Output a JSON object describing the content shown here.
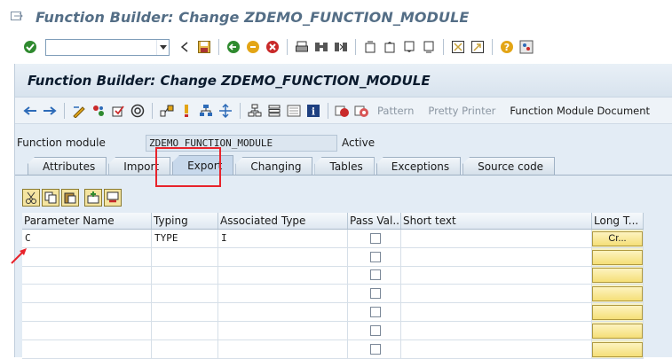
{
  "window": {
    "title": "Function Builder: Change ZDEMO_FUNCTION_MODULE"
  },
  "app": {
    "title": "Function Builder: Change ZDEMO_FUNCTION_MODULE"
  },
  "app_toolbar": {
    "pattern_label": "Pattern",
    "pretty_printer_label": "Pretty Printer",
    "fm_doc_label": "Function Module Document"
  },
  "function_module": {
    "label": "Function module",
    "value": "ZDEMO_FUNCTION_MODULE",
    "status": "Active"
  },
  "tabs": [
    {
      "label": "Attributes"
    },
    {
      "label": "Import"
    },
    {
      "label": "Export"
    },
    {
      "label": "Changing"
    },
    {
      "label": "Tables"
    },
    {
      "label": "Exceptions"
    },
    {
      "label": "Source code"
    }
  ],
  "table": {
    "headers": [
      "Parameter Name",
      "Typing",
      "Associated Type",
      "Pass Val...",
      "Short text",
      "Long T..."
    ],
    "rows": [
      {
        "param": "C",
        "typing": "TYPE",
        "assoc": "I",
        "long_btn": "Cr..."
      },
      {
        "param": "",
        "typing": "",
        "assoc": "",
        "long_btn": ""
      },
      {
        "param": "",
        "typing": "",
        "assoc": "",
        "long_btn": ""
      },
      {
        "param": "",
        "typing": "",
        "assoc": "",
        "long_btn": ""
      },
      {
        "param": "",
        "typing": "",
        "assoc": "",
        "long_btn": ""
      },
      {
        "param": "",
        "typing": "",
        "assoc": "",
        "long_btn": ""
      },
      {
        "param": "",
        "typing": "",
        "assoc": "",
        "long_btn": ""
      }
    ]
  },
  "colors": {
    "highlight": "#e8232b",
    "app_bg": "#e3ecf5",
    "long_text_yellow": "#f7f2c8"
  }
}
